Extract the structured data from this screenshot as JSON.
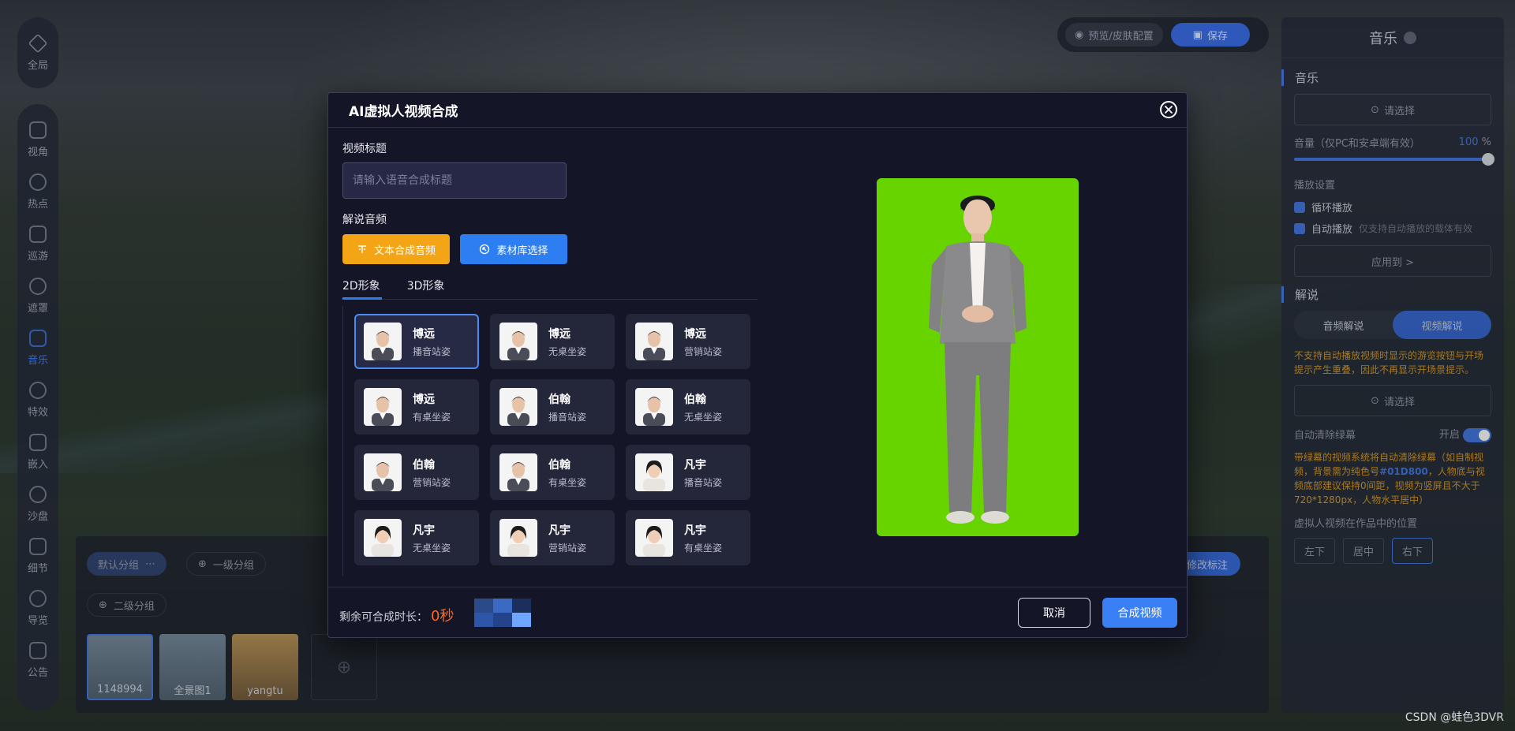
{
  "left_toolbar": {
    "global_label": "全局",
    "items": [
      {
        "label": "视角",
        "icon": "camera-view-icon"
      },
      {
        "label": "热点",
        "icon": "hotspot-icon"
      },
      {
        "label": "巡游",
        "icon": "tour-icon"
      },
      {
        "label": "遮罩",
        "icon": "mask-icon"
      },
      {
        "label": "音乐",
        "icon": "music-icon",
        "active": true
      },
      {
        "label": "特效",
        "icon": "effects-icon"
      },
      {
        "label": "嵌入",
        "icon": "embed-icon"
      },
      {
        "label": "沙盘",
        "icon": "sandbox-icon"
      },
      {
        "label": "细节",
        "icon": "detail-zoom-icon"
      },
      {
        "label": "导览",
        "icon": "guide-flag-icon"
      },
      {
        "label": "公告",
        "icon": "announcement-icon"
      }
    ]
  },
  "topbar": {
    "preview_label": "预览/皮肤配置",
    "save_label": "保存"
  },
  "right_panel": {
    "title": "音乐",
    "music_section": "音乐",
    "select_label": "请选择",
    "volume_label": "音量（仅PC和安卓端有效）",
    "volume_value": "100",
    "volume_unit": "%",
    "playback_settings": "播放设置",
    "loop_label": "循环播放",
    "autoplay_label": "自动播放",
    "autoplay_note": "仅支持自动播放的载体有效",
    "apply_to": "应用到 >",
    "narration_section": "解说",
    "tab_audio": "音频解说",
    "tab_video": "视频解说",
    "narration_warning": "不支持自动播放视频时显示的游览按钮与开场提示产生重叠，因此不再显示开场景提示。",
    "narration_select": "请选择",
    "auto_clear_label": "自动清除绿幕",
    "auto_clear_state": "开启",
    "green_warning_a": "带绿幕的视频系统将自动清除绿幕（如自制视频，背景需为纯色号",
    "green_warning_color": "#01D800",
    "green_warning_b": "，人物底与视频底部建议保持0间距，视频为竖屏且不大于720*1280px，人物水平居中）",
    "position_label": "虚拟人视频在作品中的位置",
    "positions": [
      "左下",
      "居中",
      "右下"
    ]
  },
  "bottom_strip": {
    "default_group": "默认分组",
    "level1_group": "一级分组",
    "level2_group": "二级分组",
    "edit_label": "修改标注",
    "thumbs": [
      "1148994",
      "全景图1",
      "yangtu"
    ]
  },
  "modal": {
    "title": "AI虚拟人视频合成",
    "video_title_label": "视频标题",
    "video_title_placeholder": "请输入语音合成标题",
    "narration_audio_label": "解说音频",
    "tts_button": "文本合成音频",
    "library_button": "素材库选择",
    "tabs": [
      "2D形象",
      "3D形象"
    ],
    "avatars": [
      {
        "name": "博远",
        "pose": "播音站姿",
        "gender": "m"
      },
      {
        "name": "博远",
        "pose": "无桌坐姿",
        "gender": "m"
      },
      {
        "name": "博远",
        "pose": "营销站姿",
        "gender": "m"
      },
      {
        "name": "博远",
        "pose": "有桌坐姿",
        "gender": "m"
      },
      {
        "name": "伯翰",
        "pose": "播音站姿",
        "gender": "m"
      },
      {
        "name": "伯翰",
        "pose": "无桌坐姿",
        "gender": "m"
      },
      {
        "name": "伯翰",
        "pose": "营销站姿",
        "gender": "m"
      },
      {
        "name": "伯翰",
        "pose": "有桌坐姿",
        "gender": "m"
      },
      {
        "name": "凡宇",
        "pose": "播音站姿",
        "gender": "f"
      },
      {
        "name": "凡宇",
        "pose": "无桌坐姿",
        "gender": "f"
      },
      {
        "name": "凡宇",
        "pose": "营销站姿",
        "gender": "f"
      },
      {
        "name": "凡宇",
        "pose": "有桌坐姿",
        "gender": "f"
      }
    ],
    "selected_index": 0,
    "remaining_label": "剩余可合成时长：",
    "remaining_value": "0秒",
    "cancel_label": "取消",
    "submit_label": "合成视频",
    "preview_bg": "#67d400"
  },
  "watermark": "CSDN @蛙色3DVR",
  "colors": {
    "accent": "#2d7ff1",
    "amber": "#f4a516",
    "warning_orange": "#ff6a1a"
  }
}
